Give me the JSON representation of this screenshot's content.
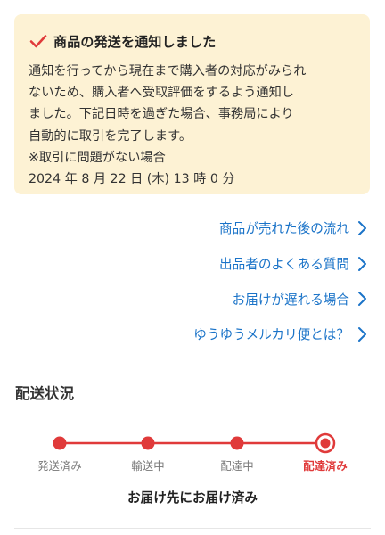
{
  "notice": {
    "title": "商品の発送を通知しました",
    "lines": [
      "通知を行ってから現在まで購入者の対応がみられ",
      "ないため、購入者へ受取評価をするよう通知し",
      "ました。下記日時を過ぎた場合、事務局により",
      "自動的に取引を完了します。",
      "※取引に問題がない場合",
      "2024 年 8 月 22 日 (木) 13 時 0 分"
    ]
  },
  "links": [
    {
      "label": "商品が売れた後の流れ"
    },
    {
      "label": "出品者のよくある質問"
    },
    {
      "label": "お届けが遅れる場合"
    },
    {
      "label": "ゆうゆうメルカリ便とは？"
    }
  ],
  "shipping": {
    "title": "配送状況",
    "steps": [
      {
        "label": "発送済み",
        "active": false
      },
      {
        "label": "輸送中",
        "active": false
      },
      {
        "label": "配達中",
        "active": false
      },
      {
        "label": "配達済み",
        "active": true
      }
    ],
    "status_message": "お届け先にお届け済み"
  },
  "colors": {
    "accent": "#e03a3a",
    "link": "#1a73c8",
    "notice_bg": "#fdf2d4"
  }
}
